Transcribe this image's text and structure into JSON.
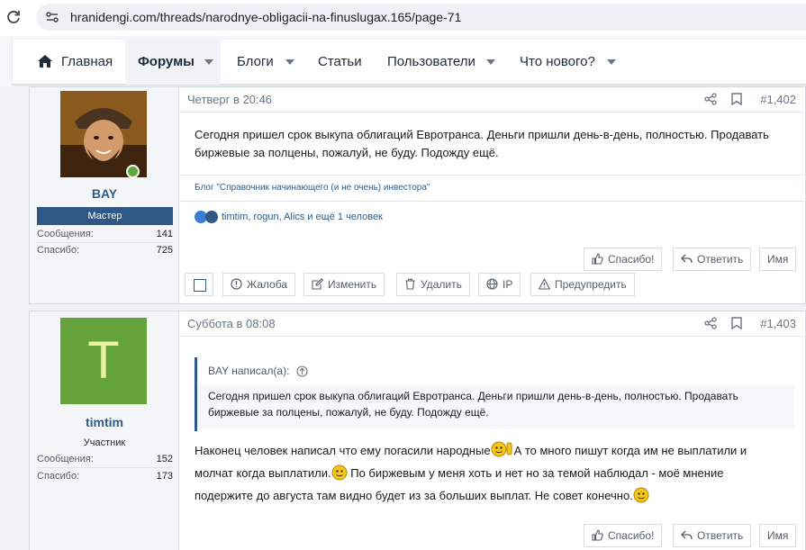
{
  "browser": {
    "url": "hranidengi.com/threads/narodnye-obligacii-na-finuslugax.165/page-71"
  },
  "nav": {
    "items": [
      {
        "label": "Главная"
      },
      {
        "label": "Форумы"
      },
      {
        "label": "Блоги"
      },
      {
        "label": "Статьи"
      },
      {
        "label": "Пользователи"
      },
      {
        "label": "Что нового?"
      }
    ]
  },
  "posts": [
    {
      "user": {
        "name": "BAY",
        "rank": "Мастер",
        "stats": [
          {
            "label": "Сообщения:",
            "value": "141"
          },
          {
            "label": "Спасибо:",
            "value": "725"
          }
        ]
      },
      "date": "Четверг в 20:46",
      "number": "#1,402",
      "text": "Сегодня пришел срок выкупа облигаций Евротранса. Деньги пришли день-в-день, полностью. Продавать биржевые за полцены, пожалуй, не буду. Подожду ещё.",
      "blog": "Блог \"Справочник начинающего (и не очень) инвестора\"",
      "reactions": "timtim, rogun, Alics и ещё 1 человек",
      "actions": {
        "thanks": "Спасибо!",
        "reply": "Ответить",
        "name": "Имя",
        "report": "Жалоба",
        "edit": "Изменить",
        "delete": "Удалить",
        "ip": "IP",
        "warn": "Предупредить"
      }
    },
    {
      "user": {
        "name": "timtim",
        "initial": "T",
        "rank": "Участник",
        "stats": [
          {
            "label": "Сообщения:",
            "value": "152"
          },
          {
            "label": "Спасибо:",
            "value": "173"
          }
        ]
      },
      "date": "Суббота в 08:08",
      "number": "#1,403",
      "quote": {
        "author": "BAY написал(а):",
        "text": "Сегодня пришел срок выкупа облигаций Евротранса. Деньги пришли день-в-день, полностью. Продавать биржевые за полцены, пожалуй, не буду. Подожду ещё."
      },
      "text_1": "Наконец человек написал что ему погасили народные",
      "text_2": "А то много пишут когда им не выплатили и молчат когда выплатили.",
      "text_3": " По биржевым у меня хоть и нет но за темой наблюдал - моё мнение подержите до августа там видно будет из за больших выплат. Не совет конечно.",
      "actions": {
        "thanks": "Спасибо!",
        "reply": "Ответить",
        "name": "Имя"
      }
    }
  ],
  "colors": {
    "accent": "#2f5887",
    "avatar_bg": "#64a33a",
    "online": "#5ea93e"
  }
}
